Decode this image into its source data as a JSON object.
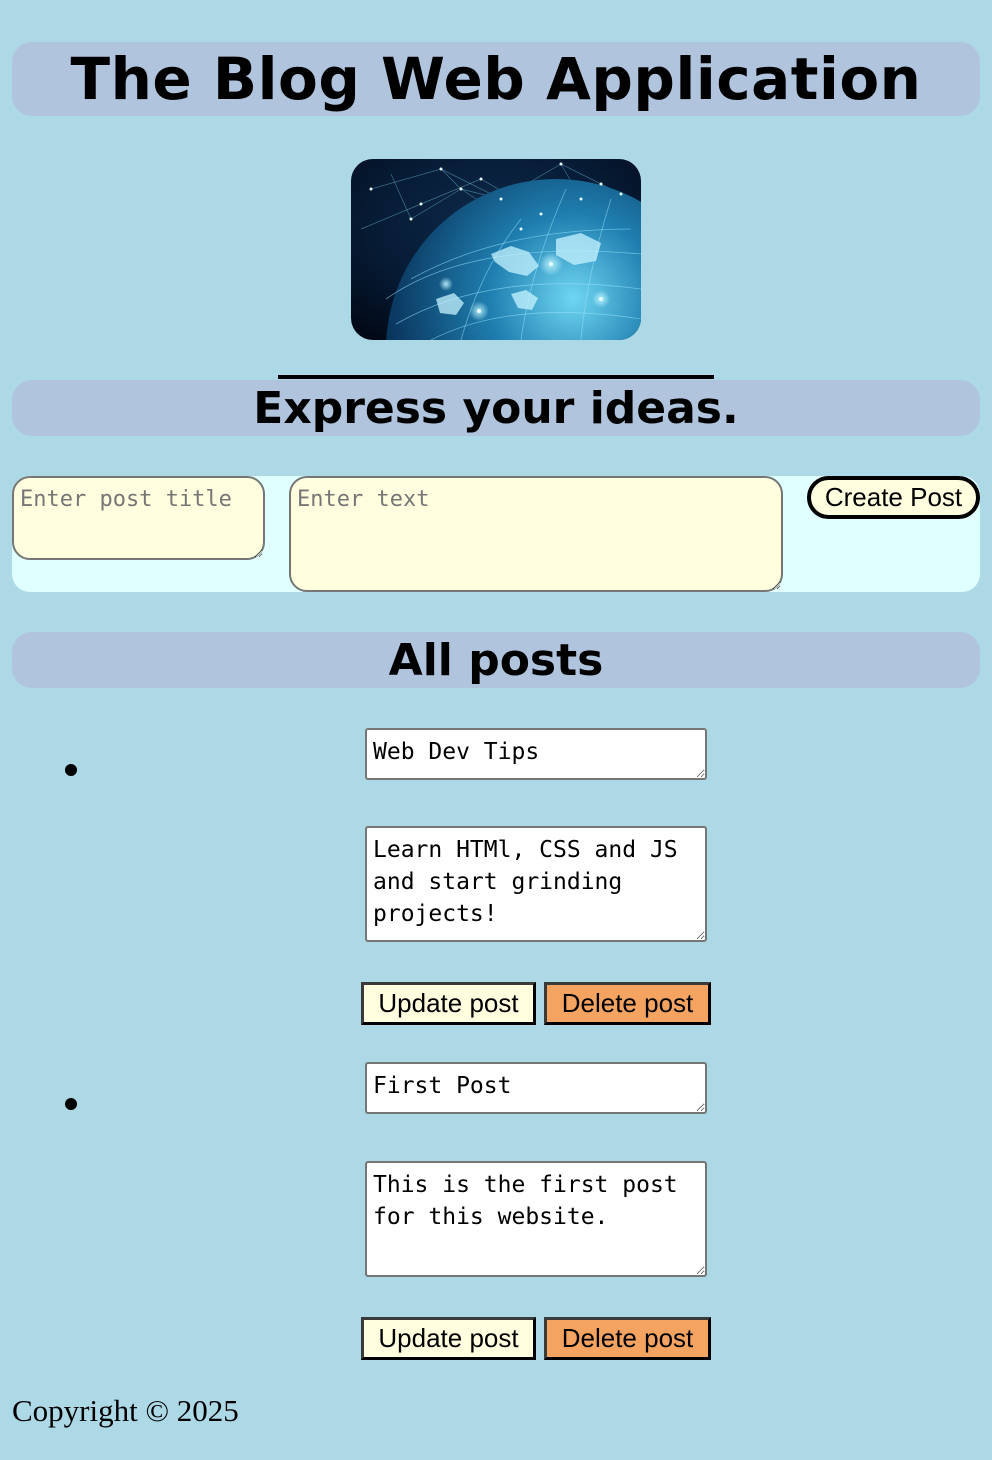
{
  "header": {
    "title": "The Blog Web Application"
  },
  "hero": {
    "icon": "globe-network-image"
  },
  "compose": {
    "heading": "Express your ideas.",
    "title_placeholder": "Enter post title",
    "body_placeholder": "Enter text",
    "create_label": "Create Post"
  },
  "posts_section": {
    "heading": "All posts",
    "posts": [
      {
        "title": "Web Dev Tips",
        "body": "Learn HTMl, CSS and JS and start grinding projects!",
        "update_label": "Update post",
        "delete_label": "Delete post"
      },
      {
        "title": "First Post",
        "body": "This is the first post for this website.",
        "update_label": "Update post",
        "delete_label": "Delete post"
      }
    ]
  },
  "footer": {
    "copyright": "Copyright © 2025"
  },
  "colors": {
    "page_background": "#add8e6",
    "banner_background": "#b0c4de",
    "form_background": "#e0ffff",
    "input_background": "#ffffe0",
    "delete_button": "#f4a460"
  }
}
